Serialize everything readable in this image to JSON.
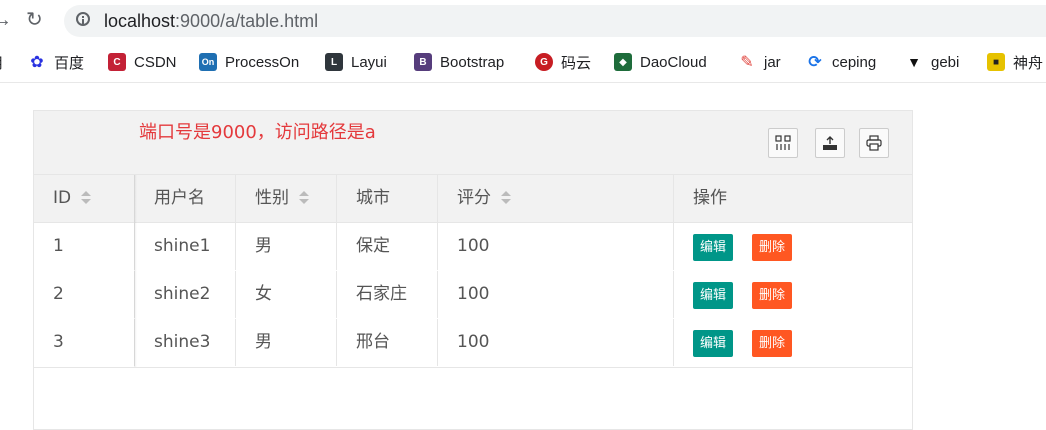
{
  "browser": {
    "url_host": "localhost",
    "url_path": ":9000/a/table.html",
    "bookmarks": [
      {
        "label": "百度",
        "icon": "paw-icon",
        "color": "#2932e1"
      },
      {
        "label": "CSDN",
        "icon": "csdn-icon",
        "color": "#c32136"
      },
      {
        "label": "ProcessOn",
        "icon": "processon-icon",
        "color": "#1f6fb2"
      },
      {
        "label": "Layui",
        "icon": "layui-icon",
        "color": "#2f363c"
      },
      {
        "label": "Bootstrap",
        "icon": "bootstrap-icon",
        "color": "#563d7c"
      },
      {
        "label": "码云",
        "icon": "gitee-icon",
        "color": "#c71d23"
      },
      {
        "label": "DaoCloud",
        "icon": "daocloud-icon",
        "color": "#1e6c3b"
      },
      {
        "label": "jar",
        "icon": "pen-icon",
        "color": "#e0443e"
      },
      {
        "label": "ceping",
        "icon": "ceping-icon",
        "color": "#1a73e8"
      },
      {
        "label": "gebi",
        "icon": "gebi-icon",
        "color": "#111111"
      },
      {
        "label": "神舟",
        "icon": "shenzhou-icon",
        "color": "#e6c200"
      }
    ]
  },
  "table": {
    "note": "端口号是9000，访问路径是a",
    "headers": {
      "id": "ID",
      "username": "用户名",
      "sex": "性别",
      "city": "城市",
      "score": "评分",
      "action": "操作"
    },
    "rows": [
      {
        "id": "1",
        "username": "shine1",
        "sex": "男",
        "city": "保定",
        "score": "100"
      },
      {
        "id": "2",
        "username": "shine2",
        "sex": "女",
        "city": "石家庄",
        "score": "100"
      },
      {
        "id": "3",
        "username": "shine3",
        "sex": "男",
        "city": "邢台",
        "score": "100"
      }
    ],
    "edit_label": "编辑",
    "delete_label": "删除",
    "colors": {
      "edit": "#009688",
      "delete": "#ff5722",
      "note": "#e4393c"
    }
  }
}
